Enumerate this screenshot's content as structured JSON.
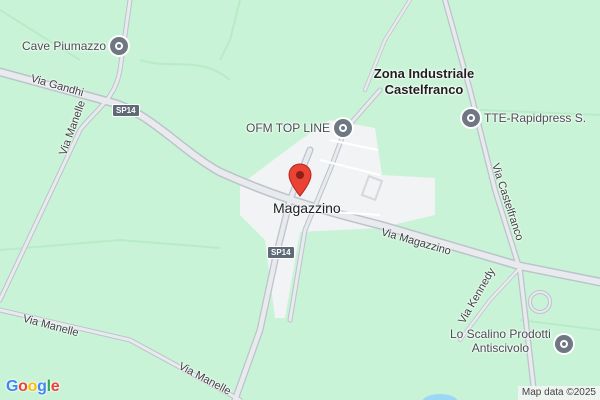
{
  "map": {
    "colors": {
      "land": "#c9f3d6",
      "urban": "#f1f3f4",
      "road": "#e3e6ea",
      "road_edge": "#b9c0c9",
      "pin": "#ea4335"
    },
    "pin_label": "Magazzino",
    "areas": [
      {
        "line1": "Zona Industriale",
        "line2": "Castelfranco"
      }
    ],
    "pois": [
      {
        "name": "Cave Piumazzo",
        "icon": "poi-icon"
      },
      {
        "name": "OFM TOP LINE",
        "icon": "poi-icon"
      },
      {
        "name": "TTE-Rapidpress S.",
        "icon": "poi-icon"
      },
      {
        "name": "Lo Scalino Prodotti Antiscivolo",
        "line1": "Lo Scalino Prodotti",
        "line2": "Antiscivolo",
        "icon": "poi-icon"
      }
    ],
    "roads": {
      "via_gandhi": "Via Gandhi",
      "via_manelle_a": "Via Manelle",
      "via_manelle_b": "Via Manelle",
      "via_manelle_c": "Via Manelle",
      "via_magazzino": "Via Magazzino",
      "via_castelfranco": "Via Castelfranco",
      "via_kennedy": "Via Kennedy"
    },
    "shields": {
      "sp14_a": "SP14",
      "sp14_b": "SP14"
    },
    "logo": {
      "letters": [
        "G",
        "o",
        "o",
        "g",
        "l",
        "e"
      ],
      "colors": [
        "#4285f4",
        "#ea4335",
        "#fbbc05",
        "#4285f4",
        "#34a853",
        "#ea4335"
      ]
    },
    "attribution": "Map data ©2025"
  }
}
